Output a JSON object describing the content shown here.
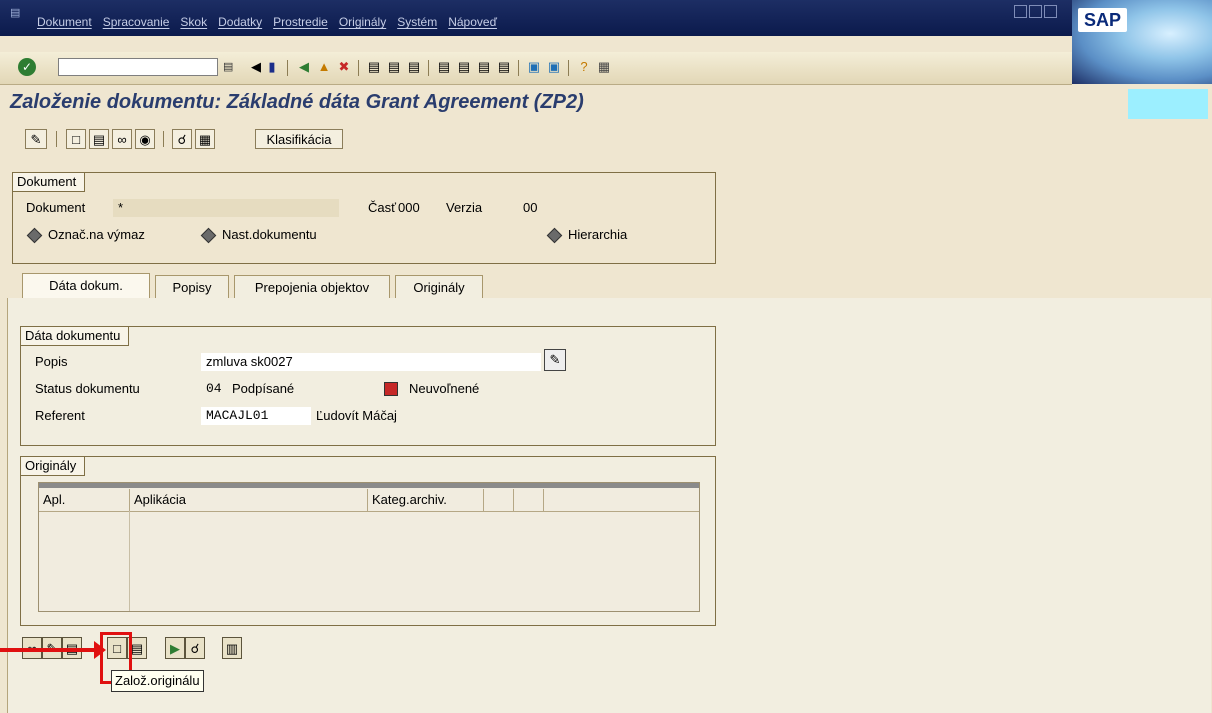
{
  "menubar": {
    "items": [
      "Dokument",
      "Spracovanie",
      "Skok",
      "Dodatky",
      "Prostredie",
      "Originály",
      "Systém",
      "Nápoveď"
    ],
    "logo": "SAP"
  },
  "title": "Založenie dokumentu: Základné dáta Grant Agreement (ZP2)",
  "appbar": {
    "classification_label": "Klasifikácia"
  },
  "dokument_group": {
    "title": "Dokument",
    "dokument_label": "Dokument",
    "dokument_value": "*",
    "cast_label": "Časť",
    "cast_value": "000",
    "verzia_label": "Verzia",
    "verzia_value": "00",
    "opt1": "Označ.na výmaz",
    "opt2": "Nast.dokumentu",
    "opt3": "Hierarchia"
  },
  "tabs": [
    "Dáta dokum.",
    "Popisy",
    "Prepojenia objektov",
    "Originály"
  ],
  "data_group": {
    "title": "Dáta dokumentu",
    "popis_label": "Popis",
    "popis_value": "zmluva sk0027",
    "status_label": "Status dokumentu",
    "status_code": "04",
    "status_text": "Podpísané",
    "release_text": "Neuvoľnené",
    "referent_label": "Referent",
    "referent_id": "MACAJL01",
    "referent_name": "Ľudovít Máčaj"
  },
  "originals_group": {
    "title": "Originály",
    "columns": [
      "Apl.",
      "Aplikácia",
      "Kateg.archiv."
    ]
  },
  "tooltip": "Založ.originálu",
  "colors": {
    "menubar": "#0b1a4c",
    "title": "#2a3d6e",
    "highlight": "#e01010"
  }
}
